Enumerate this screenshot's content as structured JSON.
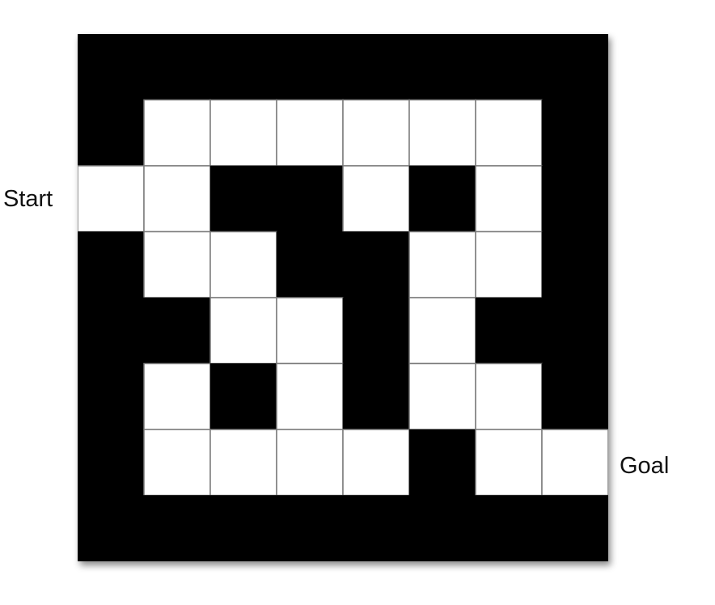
{
  "labels": {
    "start": "Start",
    "goal": "Goal"
  },
  "maze": {
    "rows": 8,
    "cols": 8,
    "wall_color": "#000000",
    "open_color": "#ffffff",
    "grid_line_color": "#7a7a7a",
    "grid": [
      [
        1,
        1,
        1,
        1,
        1,
        1,
        1,
        1
      ],
      [
        1,
        0,
        0,
        0,
        0,
        0,
        0,
        1
      ],
      [
        0,
        0,
        1,
        1,
        0,
        1,
        0,
        1
      ],
      [
        1,
        0,
        0,
        1,
        1,
        0,
        0,
        1
      ],
      [
        1,
        1,
        0,
        0,
        1,
        0,
        1,
        1
      ],
      [
        1,
        0,
        1,
        0,
        1,
        0,
        0,
        1
      ],
      [
        1,
        0,
        0,
        0,
        0,
        1,
        0,
        0
      ],
      [
        1,
        1,
        1,
        1,
        1,
        1,
        1,
        1
      ]
    ]
  }
}
